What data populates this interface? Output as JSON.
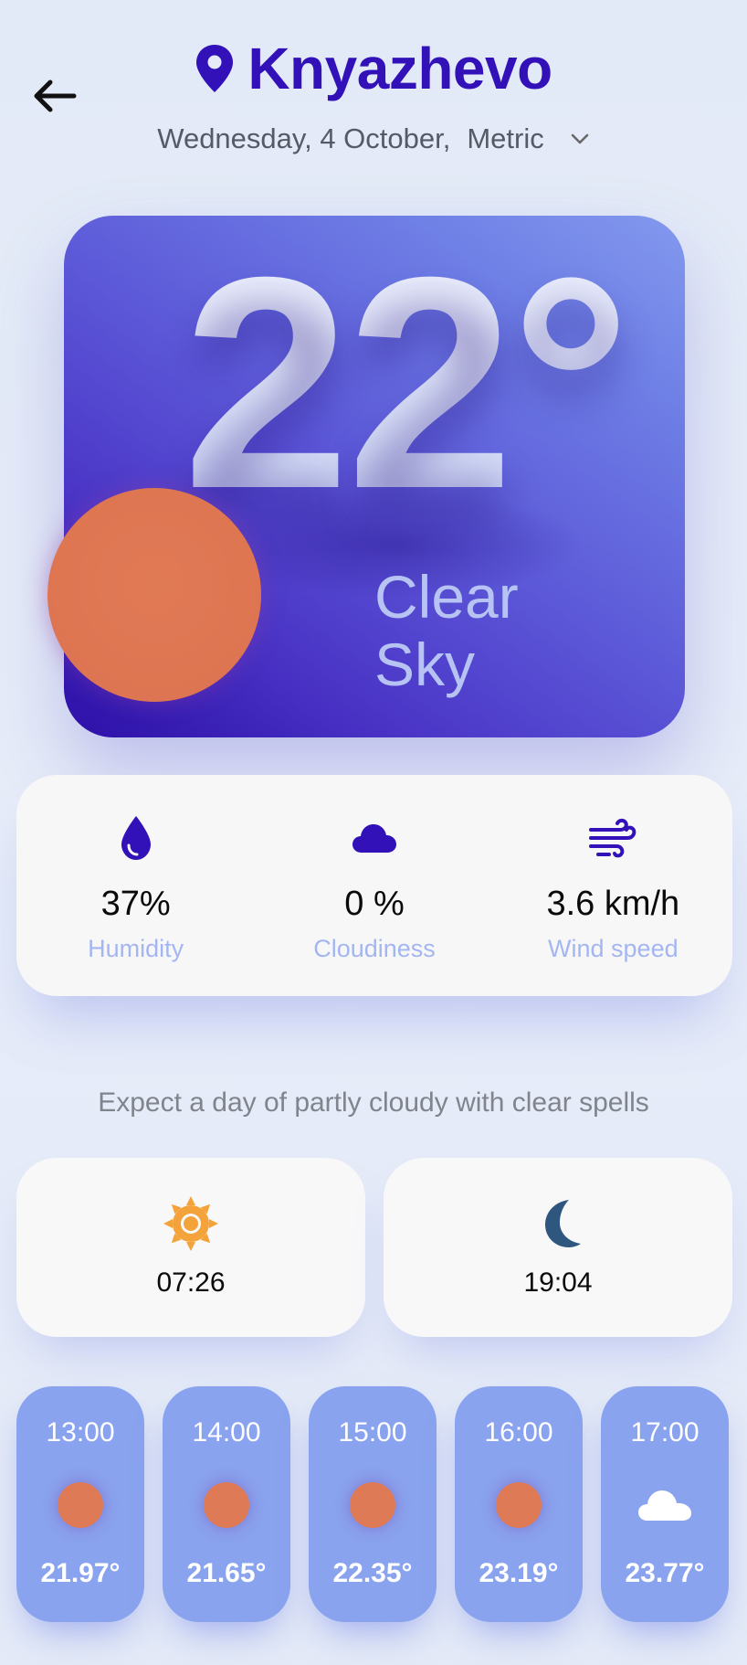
{
  "header": {
    "back_icon": "arrow-left-icon",
    "location_icon": "map-pin-icon",
    "city": "Knyazhevo",
    "date": "Wednesday, 4 October,",
    "units": "Metric",
    "units_icon": "chevron-down-icon"
  },
  "current": {
    "temperature": "22°",
    "condition_line1": "Clear",
    "condition_line2": "Sky",
    "condition_icon": "sun-icon"
  },
  "stats": [
    {
      "icon": "droplet-icon",
      "value": "37%",
      "label": "Humidity"
    },
    {
      "icon": "cloud-icon",
      "value": "0 %",
      "label": "Cloudiness"
    },
    {
      "icon": "wind-icon",
      "value": "3.6 km/h",
      "label": "Wind speed"
    }
  ],
  "forecast_text": "Expect a day of partly cloudy with clear spells",
  "sun": {
    "sunrise": {
      "icon": "sun-icon",
      "time": "07:26"
    },
    "sunset": {
      "icon": "moon-icon",
      "time": "19:04"
    }
  },
  "hourly": [
    {
      "time": "13:00",
      "icon": "sun-icon",
      "temp": "21.97°"
    },
    {
      "time": "14:00",
      "icon": "sun-icon",
      "temp": "21.65°"
    },
    {
      "time": "15:00",
      "icon": "sun-icon",
      "temp": "22.35°"
    },
    {
      "time": "16:00",
      "icon": "sun-icon",
      "temp": "23.19°"
    },
    {
      "time": "17:00",
      "icon": "cloud-icon",
      "temp": "23.77°"
    }
  ],
  "colors": {
    "accent": "#3211b8",
    "card_gradient_start": "#8399ee",
    "card_gradient_end": "#2c0fa7",
    "sun": "#de7552",
    "label": "#a4b6f2",
    "hour_card": "#8aa3ee"
  }
}
